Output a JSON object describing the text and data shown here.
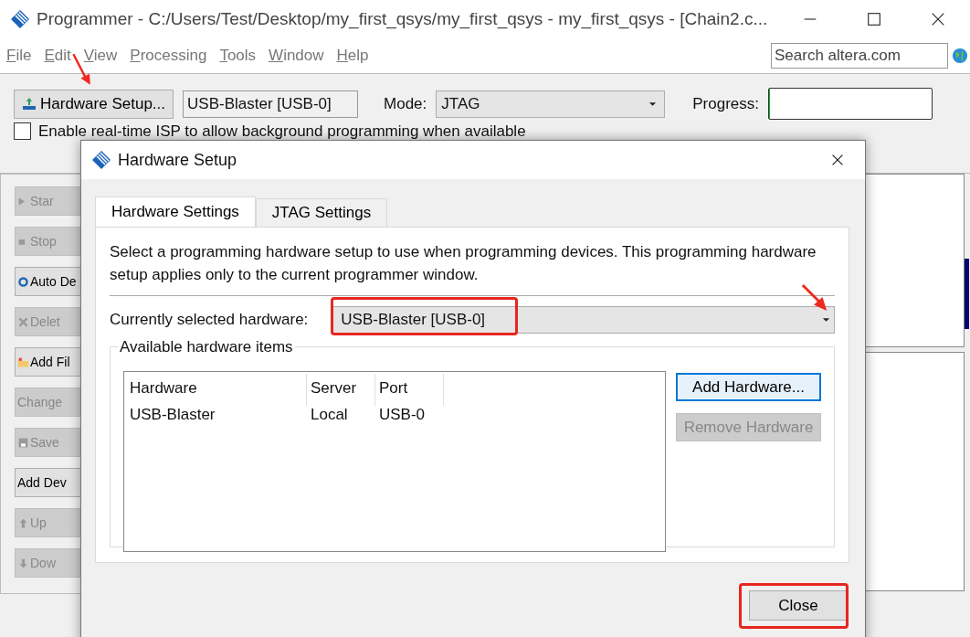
{
  "window": {
    "title": "Programmer - C:/Users/Test/Desktop/my_first_qsys/my_first_qsys - my_first_qsys - [Chain2.c..."
  },
  "menu": [
    "File",
    "Edit",
    "View",
    "Processing",
    "Tools",
    "Window",
    "Help"
  ],
  "search": {
    "placeholder": "Search altera.com"
  },
  "toolbar": {
    "setup_button": "Hardware Setup...",
    "hardware": "USB-Blaster [USB-0]",
    "mode_label": "Mode:",
    "mode": "JTAG",
    "progress_label": "Progress:",
    "progress": {
      "level": 0
    }
  },
  "isp_option": {
    "label": "Enable real-time ISP to allow background programming when available",
    "checked": false
  },
  "side_buttons": [
    {
      "label": "Star",
      "kind": "play",
      "disabled": true
    },
    {
      "label": "Stop",
      "kind": "stop",
      "disabled": true
    },
    {
      "label": "Auto De",
      "kind": "detect",
      "disabled": false
    },
    {
      "label": "Delet",
      "kind": "delete",
      "disabled": true
    },
    {
      "label": "Add Fil",
      "kind": "folder",
      "disabled": false
    },
    {
      "label": "Change",
      "kind": "none",
      "disabled": true
    },
    {
      "label": "Save",
      "kind": "save",
      "disabled": true
    },
    {
      "label": "Add Dev",
      "kind": "none",
      "disabled": false
    },
    {
      "label": "Up",
      "kind": "up",
      "disabled": true
    },
    {
      "label": "Dow",
      "kind": "down",
      "disabled": true
    }
  ],
  "dialog": {
    "title": "Hardware Setup",
    "tabs": [
      {
        "label": "Hardware Settings",
        "selected": true
      },
      {
        "label": "JTAG Settings",
        "selected": false
      }
    ],
    "description": "Select a programming hardware setup to use when programming devices. This programming hardware setup applies only to the current programmer window.",
    "hardware_label": "Currently selected hardware:",
    "hardware_value": "USB-Blaster [USB-0]",
    "group_title": "Available hardware items",
    "table": {
      "columns": [
        "Hardware",
        "Server",
        "Port"
      ],
      "rows": [
        [
          "USB-Blaster",
          "Local",
          "USB-0"
        ]
      ]
    },
    "buttons": [
      {
        "label": "Add Hardware...",
        "disabled": false
      },
      {
        "label": "Remove Hardware",
        "disabled": true
      }
    ],
    "close_button": "Close"
  }
}
